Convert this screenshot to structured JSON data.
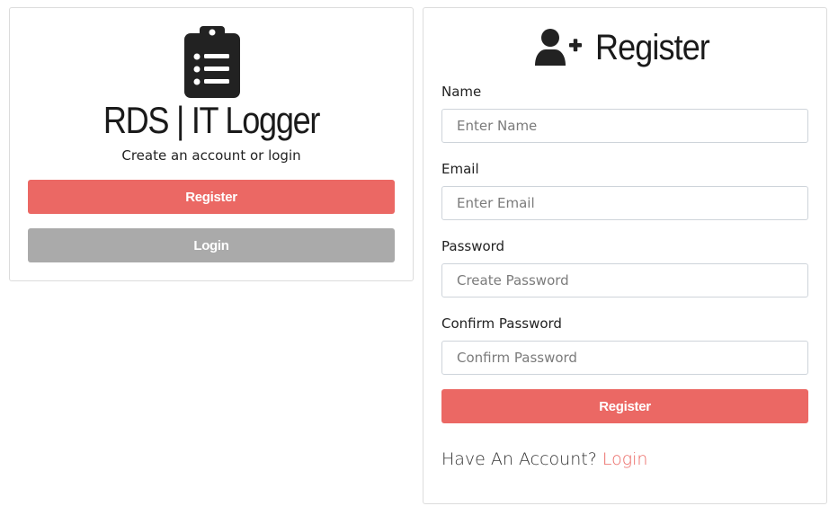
{
  "brand": {
    "title": "RDS | IT Logger",
    "subtitle": "Create an account or login",
    "icon": "clipboard-list-icon"
  },
  "left_buttons": {
    "register_label": "Register",
    "login_label": "Login"
  },
  "register_form": {
    "heading": "Register",
    "heading_icon": "user-plus-icon",
    "fields": {
      "name": {
        "label": "Name",
        "placeholder": "Enter Name",
        "value": ""
      },
      "email": {
        "label": "Email",
        "placeholder": "Enter Email",
        "value": ""
      },
      "password": {
        "label": "Password",
        "placeholder": "Create Password",
        "value": ""
      },
      "confirm": {
        "label": "Confirm Password",
        "placeholder": "Confirm Password",
        "value": ""
      }
    },
    "submit_label": "Register",
    "have_account_text": "Have An Account?",
    "login_link_label": "Login"
  },
  "colors": {
    "accent": "#eb6864",
    "secondary": "#aaaaaa",
    "icon": "#222222"
  }
}
